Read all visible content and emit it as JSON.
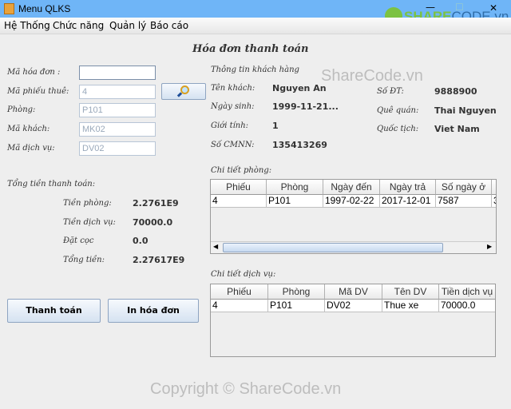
{
  "window": {
    "title": "Menu QLKS",
    "minimize": "—",
    "maximize": "☐",
    "close": "✕"
  },
  "menu": [
    "Hệ Thống",
    "Chức năng",
    "Quản lý",
    "Báo cáo"
  ],
  "page_title": "Hóa đơn thanh toán",
  "form": {
    "ma_hoa_don": {
      "label": "Mã hóa đơn :",
      "value": ""
    },
    "ma_phieu_thue": {
      "label": "Mã phiếu thuê:",
      "value": "4"
    },
    "phong": {
      "label": "Phòng:",
      "value": "P101"
    },
    "ma_khach": {
      "label": "Mã khách:",
      "value": "MK02"
    },
    "ma_dich_vu": {
      "label": "Mã dịch vụ:",
      "value": "DV02"
    }
  },
  "search_icon": "magnifier-icon",
  "totals": {
    "heading": "Tổng tiền thanh toán:",
    "items": [
      {
        "label": "Tiền phòng:",
        "value": "2.2761E9"
      },
      {
        "label": "Tiền dịch vụ:",
        "value": "70000.0"
      },
      {
        "label": "Đặt cọc",
        "value": "0.0"
      },
      {
        "label": "Tổng tiền:",
        "value": "2.27617E9"
      }
    ]
  },
  "buttons": {
    "pay": "Thanh toán",
    "print": "In hóa đơn"
  },
  "customer": {
    "heading": "Thông tin khách hàng",
    "left": [
      {
        "label": "Tên khách:",
        "value": "Nguyen An"
      },
      {
        "label": "Ngày sinh:",
        "value": "1999-11-21..."
      },
      {
        "label": "Giới tính:",
        "value": "1"
      },
      {
        "label": "Số CMNN:",
        "value": "135413269"
      }
    ],
    "right": [
      {
        "label": "Số ĐT:",
        "value": "9888900"
      },
      {
        "label": "Quê quán:",
        "value": "Thai Nguyen"
      },
      {
        "label": "Quốc tịch:",
        "value": "Viet Nam"
      }
    ]
  },
  "room_table": {
    "heading": "Chi tiết phòng:",
    "columns": [
      "Phiếu",
      "Phòng",
      "Ngày đến",
      "Ngày trả",
      "Số ngày ở",
      ""
    ],
    "rows": [
      [
        "4",
        "P101",
        "1997-02-22",
        "2017-12-01",
        "7587",
        "3"
      ]
    ]
  },
  "service_table": {
    "heading": "Chi tiết dịch vụ:",
    "columns": [
      "Phiếu",
      "Phòng",
      "Mã DV",
      "Tên DV",
      "Tiền dịch vụ"
    ],
    "rows": [
      [
        "4",
        "P101",
        "DV02",
        "Thue xe",
        "70000.0"
      ]
    ]
  },
  "watermarks": {
    "logo": "SHARECODE.vn",
    "center": "ShareCode.vn",
    "footer": "Copyright © ShareCode.vn"
  }
}
